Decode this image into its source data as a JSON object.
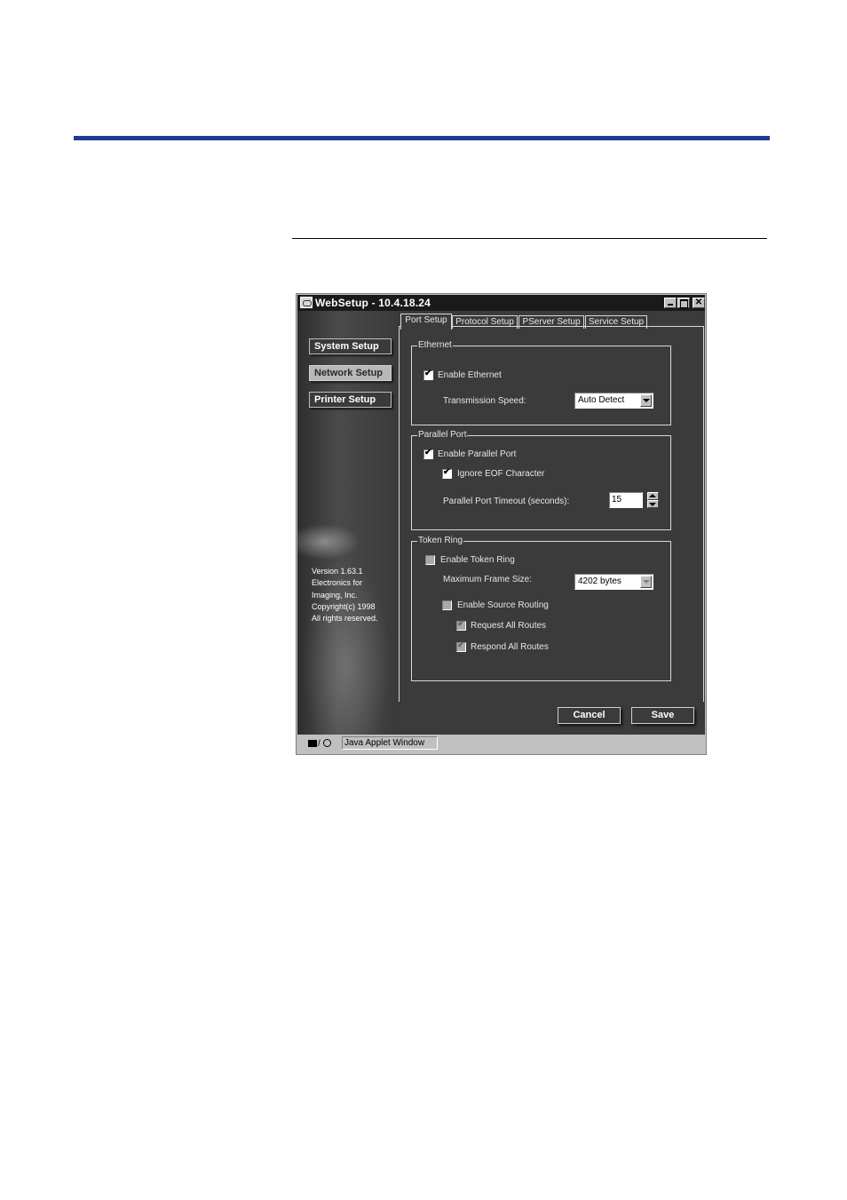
{
  "page": {
    "accent_rule_color": "#1f3a8f"
  },
  "window": {
    "title": "WebSetup - 10.4.18.24",
    "controls": {
      "minimize": "minimize",
      "maximize": "maximize",
      "close": "✕"
    }
  },
  "sidebar": {
    "items": [
      {
        "label": "System Setup",
        "active": false
      },
      {
        "label": "Network Setup",
        "active": true
      },
      {
        "label": "Printer Setup",
        "active": false
      }
    ],
    "version_lines": [
      "Version 1.63.1",
      "Electronics for",
      "Imaging, Inc.",
      "Copyright(c) 1998",
      "All rights reserved."
    ]
  },
  "tabs": [
    {
      "label": "Port Setup",
      "active": true
    },
    {
      "label": "Protocol Setup",
      "active": false
    },
    {
      "label": "PServer Setup",
      "active": false
    },
    {
      "label": "Service Setup",
      "active": false
    }
  ],
  "ethernet": {
    "legend": "Ethernet",
    "enable_label": "Enable Ethernet",
    "enable_checked": true,
    "speed_label": "Transmission Speed:",
    "speed_value": "Auto Detect"
  },
  "parallel": {
    "legend": "Parallel Port",
    "enable_label": "Enable Parallel Port",
    "enable_checked": true,
    "ignore_eof_label": "Ignore EOF Character",
    "ignore_eof_checked": true,
    "timeout_label": "Parallel Port Timeout (seconds):",
    "timeout_value": "15"
  },
  "token_ring": {
    "legend": "Token Ring",
    "enable_label": "Enable Token Ring",
    "enable_checked": false,
    "frame_size_label": "Maximum Frame Size:",
    "frame_size_value": "4202 bytes",
    "source_routing_label": "Enable Source Routing",
    "source_routing_checked": false,
    "request_routes_label": "Request All Routes",
    "request_routes_checked": true,
    "respond_routes_label": "Respond All Routes",
    "respond_routes_checked": true
  },
  "actions": {
    "cancel": "Cancel",
    "save": "Save"
  },
  "statusbar": {
    "text": "Java Applet Window"
  },
  "glyphs": {
    "check": "✔"
  }
}
